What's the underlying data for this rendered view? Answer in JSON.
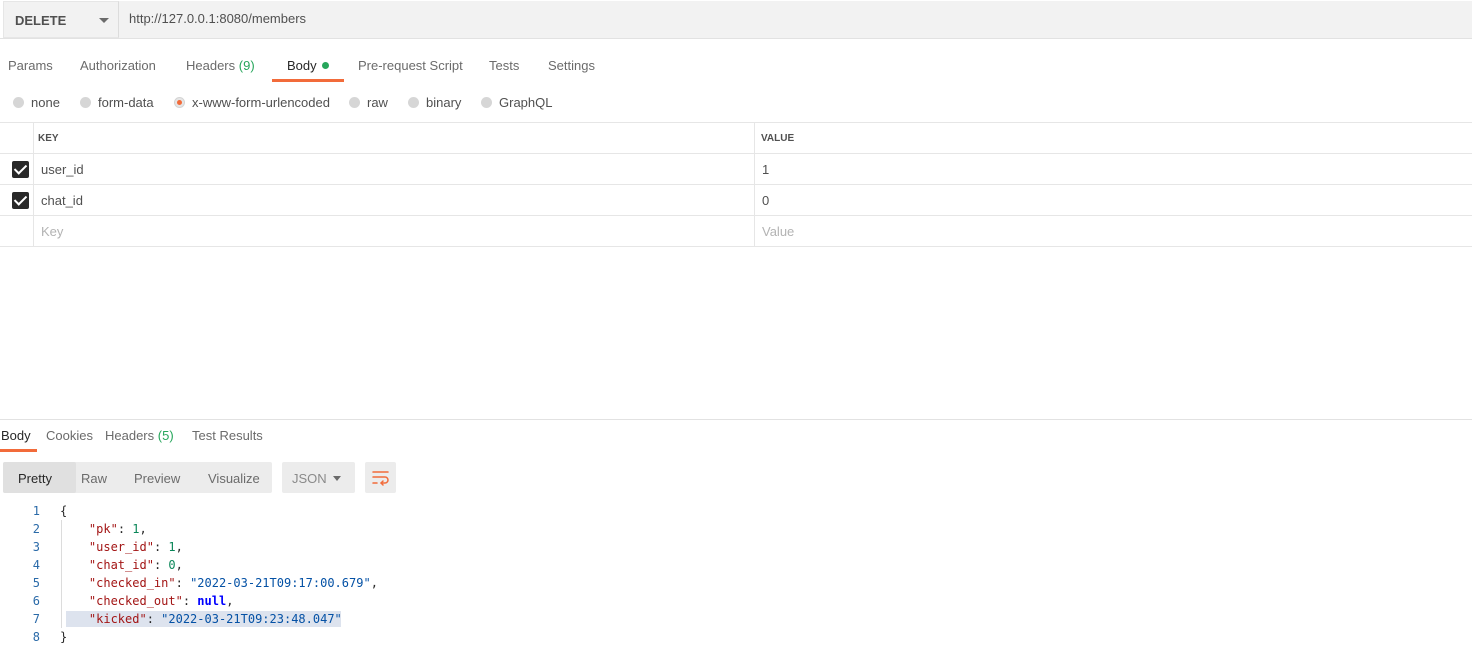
{
  "request": {
    "method": "DELETE",
    "url": "http://127.0.0.1:8080/members"
  },
  "request_tabs": [
    {
      "label": "Params"
    },
    {
      "label": "Authorization"
    },
    {
      "label": "Headers",
      "count": "(9)"
    },
    {
      "label": "Body",
      "active": true,
      "indicator": "green-dot"
    },
    {
      "label": "Pre-request Script"
    },
    {
      "label": "Tests"
    },
    {
      "label": "Settings"
    }
  ],
  "body_types": [
    {
      "label": "none"
    },
    {
      "label": "form-data"
    },
    {
      "label": "x-www-form-urlencoded",
      "selected": true
    },
    {
      "label": "raw"
    },
    {
      "label": "binary"
    },
    {
      "label": "GraphQL"
    }
  ],
  "params_table": {
    "headers": {
      "key": "KEY",
      "value": "VALUE"
    },
    "rows": [
      {
        "checked": true,
        "key": "user_id",
        "value": "1"
      },
      {
        "checked": true,
        "key": "chat_id",
        "value": "0"
      }
    ],
    "placeholder": {
      "key": "Key",
      "value": "Value"
    }
  },
  "response_tabs": [
    {
      "label": "Body",
      "active": true
    },
    {
      "label": "Cookies"
    },
    {
      "label": "Headers",
      "count": "(5)"
    },
    {
      "label": "Test Results"
    }
  ],
  "view_modes": [
    {
      "label": "Pretty",
      "active": true
    },
    {
      "label": "Raw"
    },
    {
      "label": "Preview"
    },
    {
      "label": "Visualize"
    }
  ],
  "format": "JSON",
  "wrap_icon": "wrap-lines-icon",
  "response_lines": [
    {
      "n": "1"
    },
    {
      "n": "2",
      "key": "\"pk\"",
      "val": "1"
    },
    {
      "n": "3",
      "key": "\"user_id\"",
      "val": "1"
    },
    {
      "n": "4",
      "key": "\"chat_id\"",
      "val": "0"
    },
    {
      "n": "5",
      "key": "\"checked_in\"",
      "val": "\"2022-03-21T09:17:00.679\""
    },
    {
      "n": "6",
      "key": "\"checked_out\"",
      "val": "null"
    },
    {
      "n": "7",
      "key": "\"kicked\"",
      "val": "\"2022-03-21T09:23:48.047\""
    },
    {
      "n": "8"
    }
  ],
  "colors": {
    "accent": "#f26b3a",
    "count_green": "#26a65b",
    "line_number": "#2a6aa8",
    "json_key": "#a31515",
    "json_string": "#0451a5",
    "json_number": "#098658",
    "json_null": "#0000ff",
    "highlight": "#dde3ee"
  }
}
